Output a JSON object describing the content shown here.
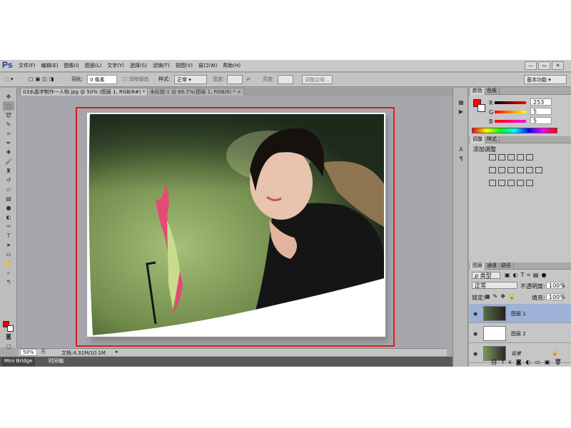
{
  "app": {
    "logo": "Ps",
    "window_controls": [
      "—",
      "▭",
      "✕"
    ]
  },
  "menu": [
    "文件(F)",
    "编辑(E)",
    "图像(I)",
    "图层(L)",
    "文字(Y)",
    "选择(S)",
    "滤镜(T)",
    "视图(V)",
    "窗口(W)",
    "帮助(H)"
  ],
  "options": {
    "feather_label": "羽化:",
    "feather_value": "0 像素",
    "antialias_label": "消除锯齿",
    "style_label": "样式:",
    "style_value": "正常",
    "width_label": "宽度:",
    "height_label": "高度:",
    "refine_edge": "调整边缘...",
    "workspace": "基本功能"
  },
  "tabs": [
    {
      "label": "03水晶字制作一人物.jpg @ 50% (图层 1, RGB/8#) *",
      "close": "×"
    },
    {
      "label": "未标题-1 @ 66.7%(图层 1, RGB/8) *",
      "close": "×"
    }
  ],
  "status": {
    "zoom": "50%",
    "doc": "文档:4.31M/10.1M"
  },
  "bottom_tabs": [
    "Mini Bridge",
    "时间轴"
  ],
  "color_panel": {
    "tabs": [
      "颜色",
      "色板"
    ],
    "r_label": "R",
    "g_label": "G",
    "b_label": "B",
    "r": "253",
    "g": "5",
    "b": "5",
    "fg_color": "#fd0505"
  },
  "adjust_panel": {
    "tabs": [
      "调整",
      "样式"
    ],
    "title": "添加调整"
  },
  "layers_panel": {
    "tabs": [
      "图层",
      "通道",
      "路径"
    ],
    "filter": "ρ 类型",
    "blend": "正常",
    "opacity_label": "不透明度:",
    "opacity": "100%",
    "lock_label": "锁定:",
    "fill_label": "填充:",
    "fill": "100%",
    "layers": [
      {
        "name": "图层 1",
        "selected": true
      },
      {
        "name": "图层 2",
        "selected": false
      },
      {
        "name": "背景",
        "selected": false,
        "locked": true
      }
    ]
  }
}
